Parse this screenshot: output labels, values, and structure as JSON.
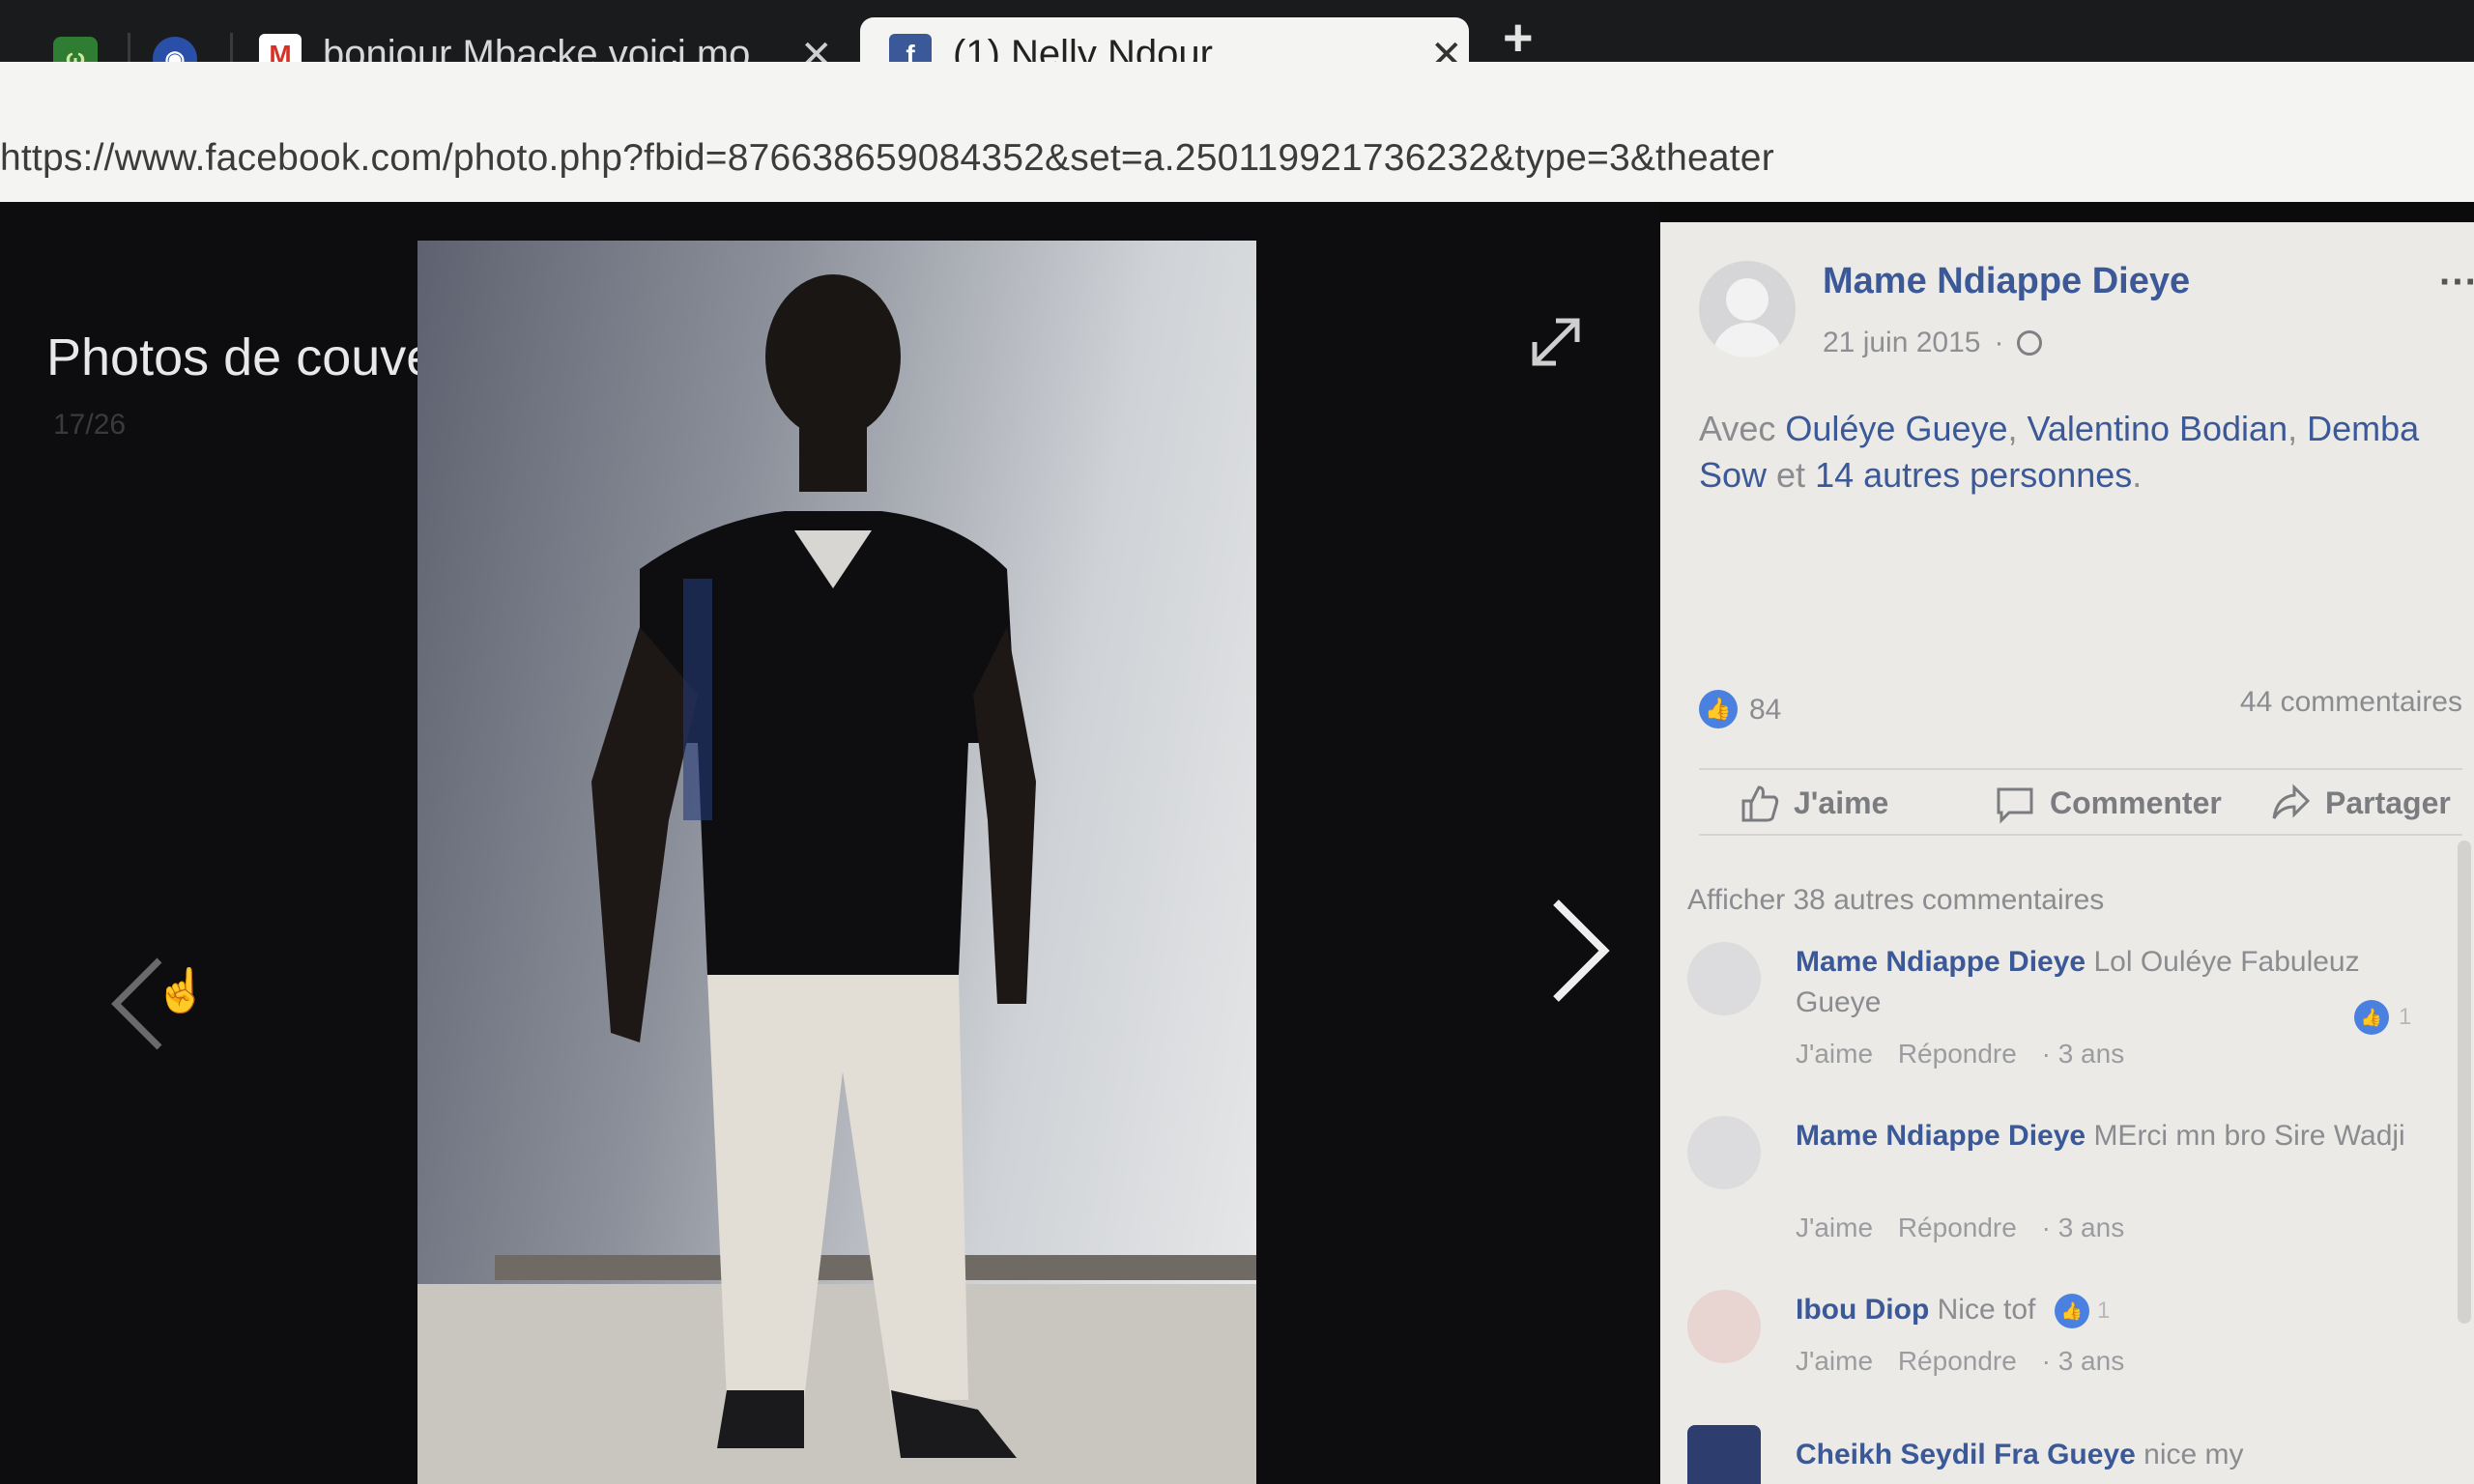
{
  "tabs": [
    {
      "label": "bonjour Mbacke voici mo",
      "close": "✕"
    },
    {
      "label": "(1) Nelly Ndour",
      "close": "✕"
    }
  ],
  "new_tab": "+",
  "url": "https://www.facebook.com/photo.php?fbid=876638659084352&set=a.250119921736232&type=3&theater",
  "theater": {
    "album_title": "Photos de couverture",
    "photo_counter": "17/26"
  },
  "post": {
    "author": "Mame Ndiappe Dieye",
    "date": "21 juin 2015",
    "more": "···",
    "with_prefix": "Avec ",
    "with_people": [
      "Ouléye Gueye",
      "Valentino Bodian",
      "Demba Sow"
    ],
    "with_sep1": ", ",
    "with_sep2": ", ",
    "with_and": " et ",
    "with_others": "14 autres personnes",
    "with_end": ".",
    "like_count": "84",
    "comments_count": "44 commentaires",
    "actions": {
      "like": "J'aime",
      "comment": "Commenter",
      "share": "Partager"
    }
  },
  "comments": {
    "view_more": "Afficher 38 autres commentaires",
    "items": [
      {
        "name": "Mame Ndiappe Dieye",
        "text": " Lol Ouléye Fabuleuz Gueye",
        "like": "J'aime",
        "reply": "Répondre",
        "age": "· 3 ans",
        "reactions": "1"
      },
      {
        "name": "Mame Ndiappe Dieye",
        "text": " MErci mn bro Sire Wadji",
        "like": "J'aime",
        "reply": "Répondre",
        "age": "· 3 ans",
        "reactions": ""
      },
      {
        "name": "Ibou Diop",
        "text": " Nice tof",
        "like": "J'aime",
        "reply": "Répondre",
        "age": "· 3 ans",
        "reactions": "1"
      },
      {
        "name": "Cheikh Seydil Fra Gueye",
        "text": " nice my",
        "like": "",
        "reply": "",
        "age": "",
        "reactions": ""
      }
    ]
  },
  "colors": {
    "facebook_blue": "#3b5998",
    "like_blue": "#4a80e0",
    "gmail_red": "#d93025"
  },
  "icons": [
    "maps-icon",
    "chrome-store-icon",
    "gmail-icon",
    "facebook-icon",
    "globe-icon",
    "expand-icon",
    "arrow-left-icon",
    "arrow-right-icon",
    "thumbs-up-icon",
    "comment-icon",
    "share-icon"
  ]
}
